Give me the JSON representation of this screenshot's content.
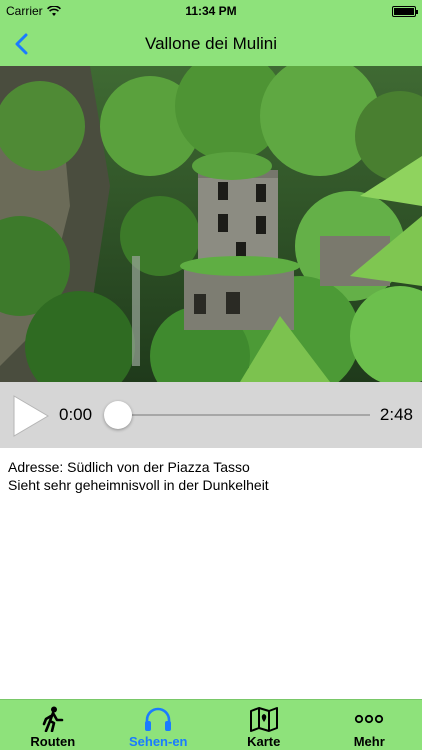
{
  "status_bar": {
    "carrier": "Carrier",
    "time": "11:34 PM"
  },
  "nav": {
    "title": "Vallone dei Mulini",
    "back_icon": "chevron-left-icon"
  },
  "colors": {
    "accent": "#1a7bff",
    "bar_green": "#8ee27b",
    "player_bg": "#d6d6d6"
  },
  "photo": {
    "subject": "ruined mill in an overgrown green gorge"
  },
  "player": {
    "current_time": "0:00",
    "total_time": "2:48",
    "progress": 0
  },
  "description": {
    "line1": "Adresse: Südlich von der Piazza Tasso",
    "line2": "Sieht sehr geheimnisvoll in der Dunkelheit"
  },
  "tabs": [
    {
      "label": "Routen",
      "icon": "walking-person-icon",
      "active": false
    },
    {
      "label": "Sehen-en",
      "icon": "headphones-icon",
      "active": true
    },
    {
      "label": "Karte",
      "icon": "map-icon",
      "active": false
    },
    {
      "label": "Mehr",
      "icon": "more-dots-icon",
      "active": false
    }
  ]
}
